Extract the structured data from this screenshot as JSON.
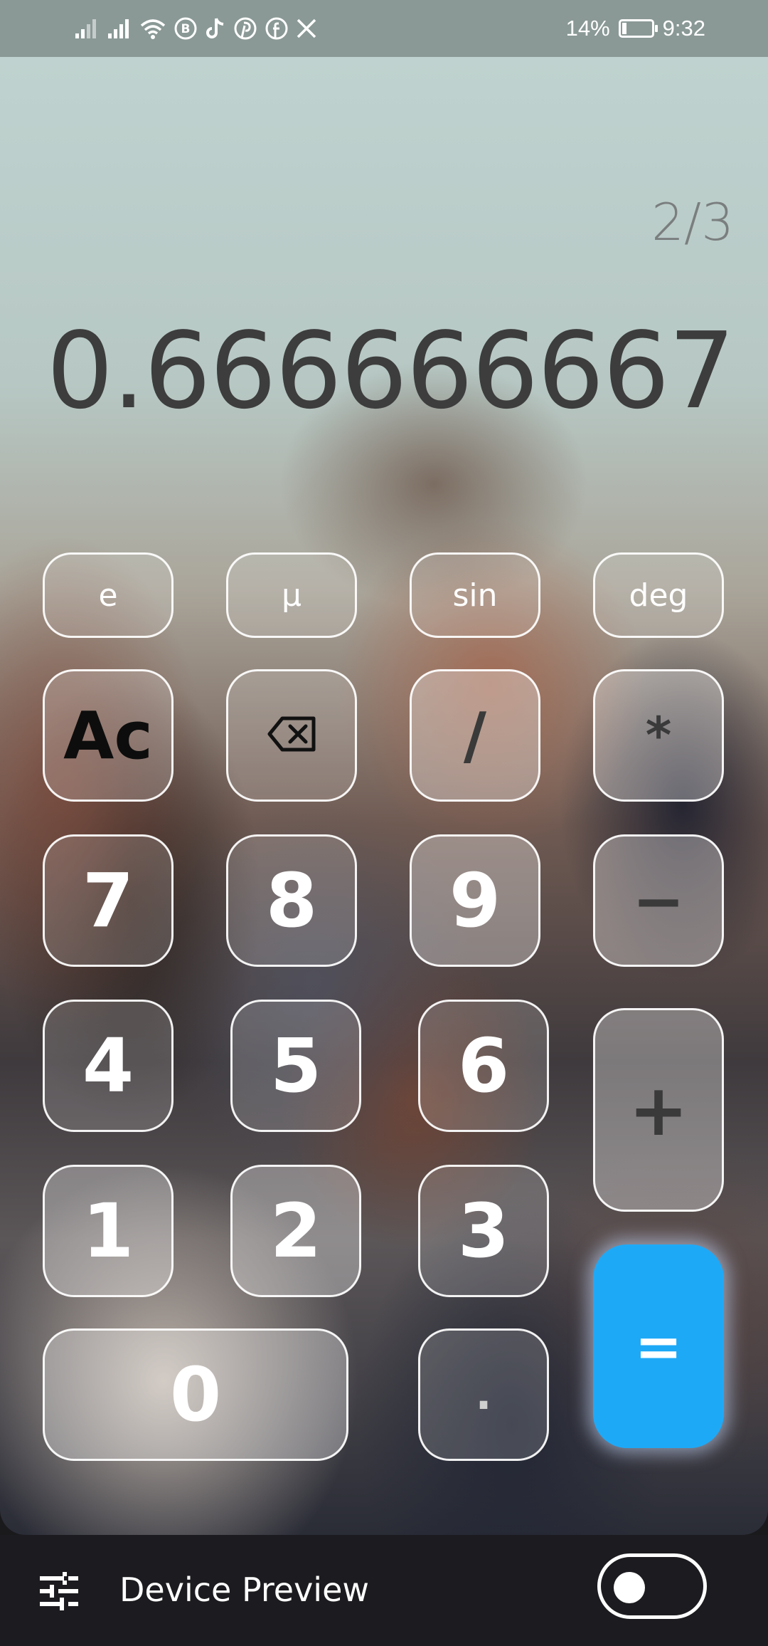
{
  "status_bar": {
    "battery_percent": "14%",
    "battery_level": 0.14,
    "time": "9:32",
    "icons": [
      "signal-icon",
      "signal-icon",
      "wifi-icon",
      "b-badge-icon",
      "tiktok-icon",
      "pinterest-icon",
      "facebook-icon",
      "x-icon",
      "battery-charging-icon"
    ]
  },
  "display": {
    "expression": "2/3",
    "result": "0.666666667"
  },
  "keys": {
    "e": "e",
    "mu": "µ",
    "sin": "sin",
    "deg": "deg",
    "clear": "Ac",
    "backspace_icon": "backspace-icon",
    "divide": "/",
    "multiply": "*",
    "seven": "7",
    "eight": "8",
    "nine": "9",
    "minus": "−",
    "four": "4",
    "five": "5",
    "six": "6",
    "plus": "+",
    "one": "1",
    "two": "2",
    "three": "3",
    "zero": "0",
    "dot": ".",
    "equals": "="
  },
  "bottom_bar": {
    "label": "Device Preview",
    "toggle_on": false
  },
  "colors": {
    "accent_equals": "#1ea9f7",
    "status_bar": "#8a9996",
    "bottom_bar": "#1c1c20"
  }
}
